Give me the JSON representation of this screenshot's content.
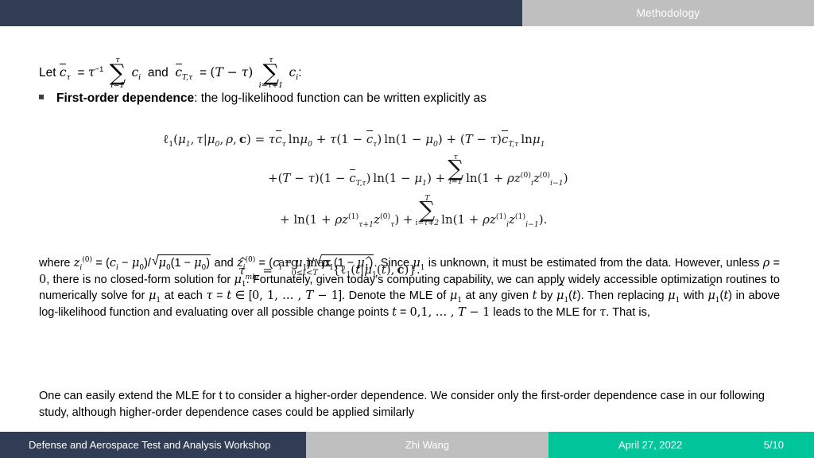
{
  "header": {
    "title": "Methodology",
    "left_color": "#313d55",
    "right_color": "#bfbfbf",
    "title_color": "#ffffff"
  },
  "content": {
    "let_line": "Let c̄τ = τ⁻¹ ∑(i=1..τ) cᵢ and c̄T,τ = (T − τ) ∑(i=τ+1..τ) cᵢ:",
    "bullet": {
      "strong": "First-order dependence",
      "rest": ": the log-likelihood function can be written explicitly as"
    },
    "equation_main": {
      "line1": "ℓ₁(μ₁, τ|μ₀, ρ, c) = τc̄τ lnμ₀ + τ(1 − c̄τ) ln(1 − μ₀) + (T − τ)c̄T,τ lnμ₁",
      "line2": "+(T − τ)(1 − c̄T,τ) ln(1 − μ₁) + ∑(i=1..τ) ln(1 + ρzᵢ⁽⁰⁾ zᵢ₋₁⁽⁰⁾)",
      "line3": "+ ln(1 + ρzτ₊₁⁽¹⁾ zτ⁽⁰⁾) + ∑(i=τ+2..T) ln(1 + ρzᵢ⁽¹⁾ zᵢ₋₁⁽¹⁾)."
    },
    "paragraph_where": "where zᵢ⁽⁰⁾ = (cᵢ − μ₀)/√(μ₀(1 − μ₀)) and zᵢ⁽⁰⁾ = (cᵢ − μ₁)/√(μ₁(1 − μ₁)). Since μ₁ is unknown, it must be estimated from the data. However, unless ρ = 0, there is no closed-form solution for μ₁. Fortunately, given today’s computing capability, we can apply widely accessible optimization routines to numerically solve for μ₁ at each τ = t ∈ [0, 1, … , T − 1]. Denote the MLE of μ₁ at any given t by μ̂₁(t). Then replacing μ₁ with μ̂₁(t) in above log-likelihood function and evaluating over all possible change points t = 0,1, … , T − 1 leads to the MLE for τ. That is,",
    "equation_mle": "τ̂mle = arg max (0≤t<T) {ℓ₁(t|μ̂₁(t), c)}.",
    "paragraph_final": "One can easily extend the MLE for t to consider a higher-order dependence. We consider only the first-order dependence case in our following study, although higher-order dependence cases could be applied similarly"
  },
  "footer": {
    "workshop": "Defense and Aerospace Test and Analysis Workshop",
    "author": "Zhi Wang",
    "date": "April 27, 2022",
    "page": "5/10",
    "left_color": "#313d55",
    "mid_color": "#bfbfbf",
    "right_color": "#00c49a"
  }
}
